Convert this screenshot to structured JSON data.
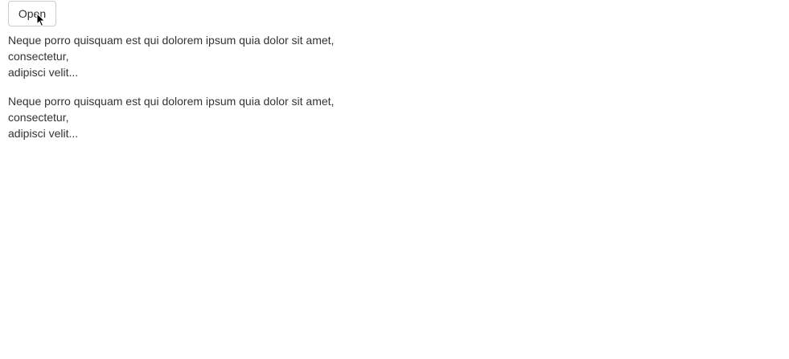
{
  "toolbar": {
    "open_label": "Open"
  },
  "paragraphs": [
    {
      "lines": [
        "Neque porro quisquam est qui dolorem ipsum quia dolor sit amet,",
        "consectetur,",
        "adipisci velit..."
      ]
    },
    {
      "lines": [
        "Neque porro quisquam est qui dolorem ipsum quia dolor sit amet,",
        "consectetur,",
        "adipisci velit..."
      ]
    }
  ],
  "icons": {
    "cursor": "mouse-pointer-icon"
  }
}
